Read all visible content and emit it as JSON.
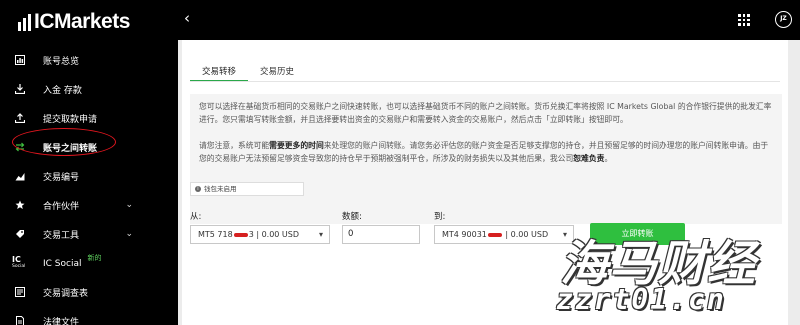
{
  "brand": {
    "logo_text": "ICMarkets"
  },
  "sidebar": {
    "items": [
      {
        "label": "账号总览",
        "icon": "bar-chart-icon"
      },
      {
        "label": "入金 存款",
        "icon": "deposit-icon"
      },
      {
        "label": "提交取款申请",
        "icon": "withdraw-icon"
      },
      {
        "label": "账号之间转账",
        "icon": "transfer-arrows-icon",
        "active": true
      },
      {
        "label": "交易编号",
        "icon": "chart-icon"
      },
      {
        "label": "合作伙伴",
        "icon": "partner-icon",
        "expandable": true
      },
      {
        "label": "交易工具",
        "icon": "tools-icon",
        "expandable": true
      },
      {
        "label": "IC Social",
        "icon": "ic-social-icon",
        "badge": "新的"
      },
      {
        "label": "交易调查表",
        "icon": "survey-icon"
      },
      {
        "label": "法律文件",
        "icon": "legal-doc-icon"
      }
    ],
    "ic_social_icon_text": "IC",
    "ic_social_icon_sub": "Social"
  },
  "topbar": {
    "avatar_initials": "JZ"
  },
  "tabs": [
    {
      "label": "交易转移",
      "active": true
    },
    {
      "label": "交易历史",
      "active": false
    }
  ],
  "info": {
    "para1": "您可以选择在基础货币相同的交易账户之间快速转账，也可以选择基础货币不同的账户之间转账。货币兑换汇率将按照 IC Markets Global 的合作银行提供的批发汇率进行。您只需填写转账金额，并且选择要转出资金的交易账户和需要转入资金的交易账户，然后点击「立即转账」按钮即可。",
    "para2_a": "请您注意，系统可能",
    "para2_bold": "需要更多的时间",
    "para2_b": "来处理您的账户间转账。请您务必评估您的账户资金是否足够支撑您的持仓，并且预留足够的时间办理您的账户间转账申请。由于您的交易账户无法预留足够资金导致您的持仓早于预期被强制平仓，所涉及的财务损失以及其他后果，我公司",
    "para2_bold2": "恕难负责",
    "para2_end": "。"
  },
  "wallet_note": "钱包未启用",
  "form": {
    "from_label": "从:",
    "from_prefix": "MT5 718",
    "from_suffix": "3 | 0.00 USD",
    "amount_label": "数额:",
    "amount_value": "0",
    "to_label": "到:",
    "to_prefix": "MT4 90031",
    "to_suffix": " | 0.00 USD",
    "submit_label": "立即转账"
  },
  "watermark": {
    "cn": "海马财经",
    "en": "zzrt01.cn"
  },
  "colors": {
    "accent": "#2fbf3f",
    "annotation": "#e0161e",
    "sidebar_bg": "#000000"
  }
}
